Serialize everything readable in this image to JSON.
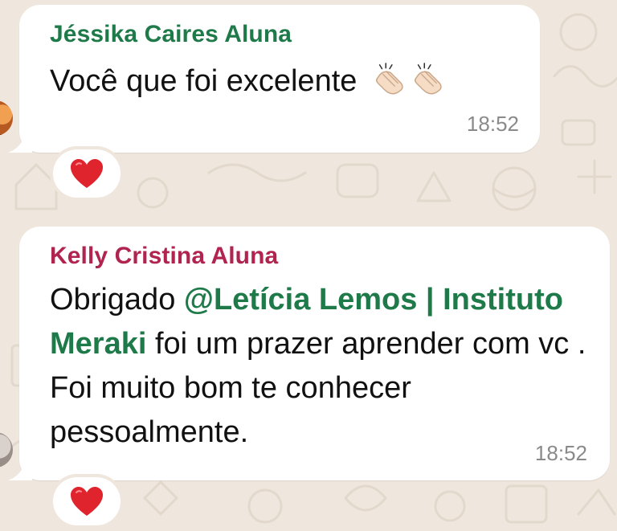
{
  "messages": [
    {
      "sender": "Jéssika Caires Aluna",
      "text": "Você que foi excelente",
      "emoji": [
        "clapping-hands-icon",
        "clapping-hands-icon"
      ],
      "time": "18:52",
      "reaction": "red-heart-icon"
    },
    {
      "sender": "Kelly Cristina Aluna",
      "text_before": "Obrigado ",
      "mention": "@Letícia Lemos | Instituto Meraki",
      "text_after": " foi um prazer aprender com vc . Foi muito bom te conhecer pessoalmente.",
      "time": "18:52",
      "reaction": "red-heart-icon"
    }
  ],
  "colors": {
    "background": "#efe7dd",
    "bubble": "#ffffff",
    "sender1": "#1f7a4a",
    "sender2": "#b0244f",
    "mention": "#1f7a4a",
    "time": "#8a8a8a",
    "heart": "#e0242d"
  }
}
